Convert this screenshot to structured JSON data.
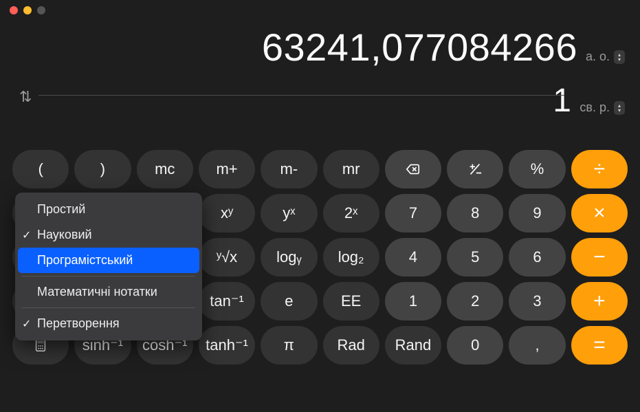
{
  "display": {
    "primary_value": "63241,077084266",
    "primary_unit": "а. о.",
    "secondary_value": "1",
    "secondary_unit": "св. р."
  },
  "menu": {
    "basic": "Простий",
    "scientific": "Науковий",
    "programmer": "Програмістський",
    "math_notes": "Математичні нотатки",
    "convert": "Перетворення"
  },
  "keys": {
    "lparen": "(",
    "rparen": ")",
    "mc": "mc",
    "mplus": "m+",
    "mminus": "m-",
    "mr": "mr",
    "plusminus": "",
    "percent": "%",
    "xy": "xʸ",
    "yx": "yˣ",
    "twox": "2ˣ",
    "yrootx": "ʸ√x",
    "logy": "logᵧ",
    "log2": "log₂",
    "taninv": "tan⁻¹",
    "e": "e",
    "EE": "EE",
    "sinhinv": "sinh⁻¹",
    "coshinv": "cosh⁻¹",
    "tanhinv": "tanh⁻¹",
    "pi": "π",
    "Rad": "Rad",
    "Rand": "Rand",
    "d0": "0",
    "d1": "1",
    "d2": "2",
    "d3": "3",
    "d4": "4",
    "d5": "5",
    "d6": "6",
    "d7": "7",
    "d8": "8",
    "d9": "9",
    "comma": ",",
    "div": "÷",
    "mul": "×",
    "minus": "−",
    "plus": "+",
    "eq": "="
  }
}
